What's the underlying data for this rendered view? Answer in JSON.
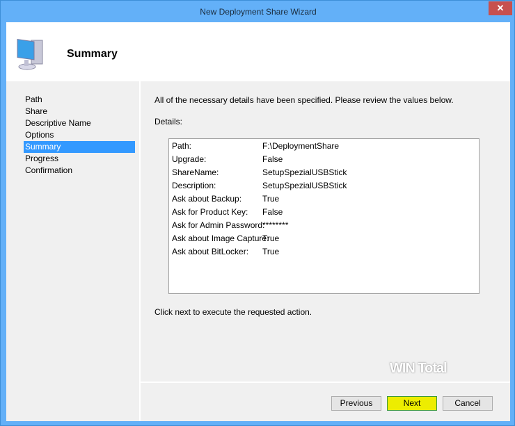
{
  "window": {
    "title": "New Deployment Share Wizard",
    "close": "✕"
  },
  "header": {
    "title": "Summary",
    "icon": "computer-icon"
  },
  "sidebar": {
    "items": [
      {
        "label": "Path"
      },
      {
        "label": "Share"
      },
      {
        "label": "Descriptive Name"
      },
      {
        "label": "Options"
      },
      {
        "label": "Summary",
        "selected": true
      },
      {
        "label": "Progress"
      },
      {
        "label": "Confirmation"
      }
    ]
  },
  "main": {
    "intro": "All of the necessary details have been specified.  Please review the values below.",
    "details_label": "Details:",
    "details": [
      {
        "k": "Path:",
        "v": "F:\\DeploymentShare"
      },
      {
        "k": "Upgrade:",
        "v": "False"
      },
      {
        "k": "ShareName:",
        "v": "SetupSpezialUSBStick"
      },
      {
        "k": "Description:",
        "v": "SetupSpezialUSBStick"
      },
      {
        "k": "Ask about Backup:",
        "v": "True"
      },
      {
        "k": "Ask for Product Key:",
        "v": "False"
      },
      {
        "k": "Ask for Admin Password:",
        "v": "********"
      },
      {
        "k": "Ask about Image Capture:",
        "v": "True"
      },
      {
        "k": "Ask about BitLocker:",
        "v": "True"
      }
    ],
    "footer_text": "Click next to execute the requested action."
  },
  "watermark": "WIN Total",
  "buttons": {
    "previous": "Previous",
    "next": "Next",
    "cancel": "Cancel"
  }
}
